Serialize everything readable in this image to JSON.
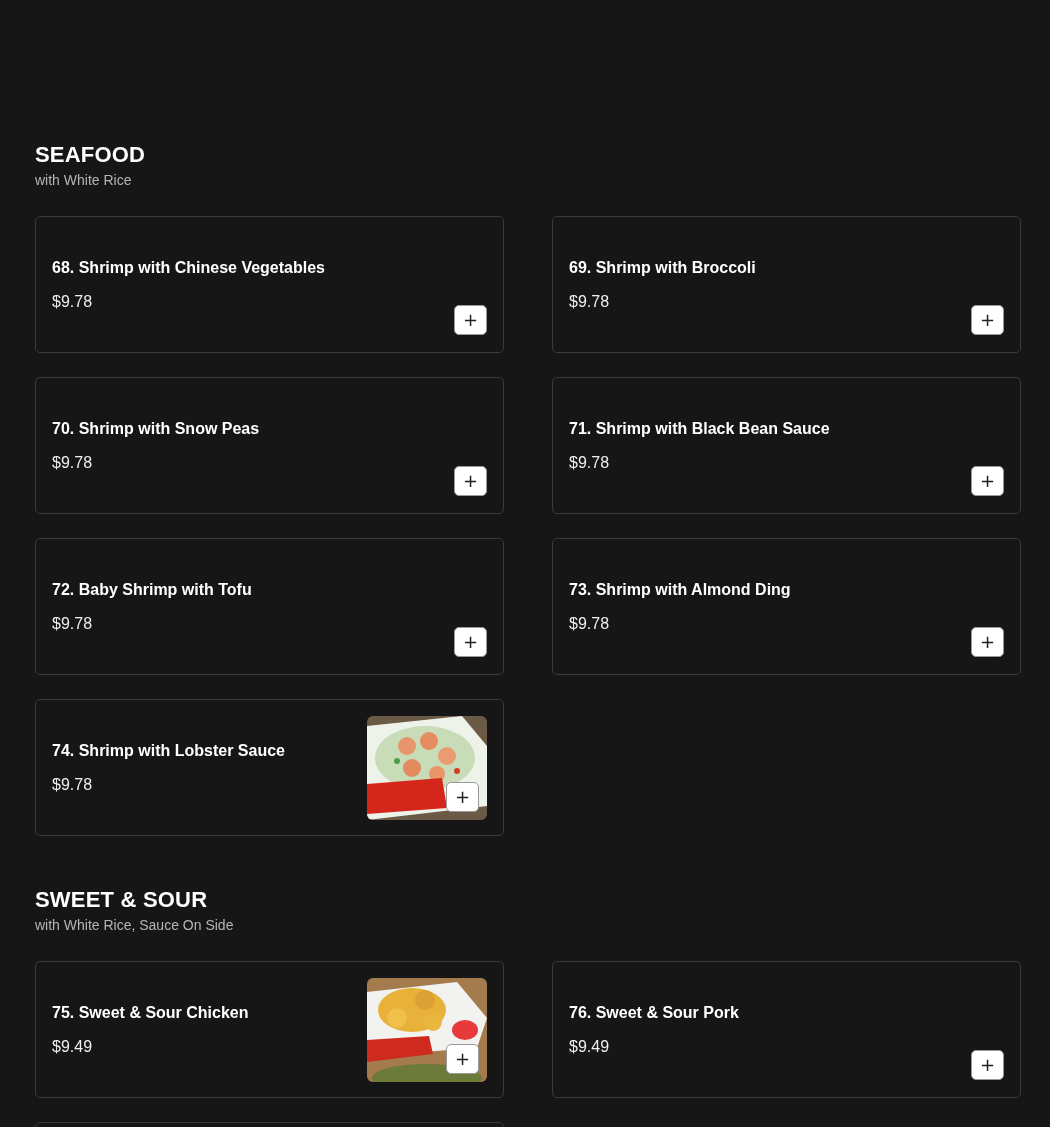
{
  "sections": [
    {
      "title": "SEAFOOD",
      "subtitle": "with White Rice",
      "items": [
        {
          "kind": "dish",
          "name": "68. Shrimp with Chinese Vegetables",
          "price": "$9.78",
          "add": "+"
        },
        {
          "kind": "dish",
          "name": "69. Shrimp with Broccoli",
          "price": "$9.78",
          "add": "+"
        },
        {
          "kind": "dish",
          "name": "70. Shrimp with Snow Peas",
          "price": "$9.78",
          "add": "+"
        },
        {
          "kind": "dish",
          "name": "71. Shrimp with Black Bean Sauce",
          "price": "$9.78",
          "add": "+"
        },
        {
          "kind": "dish",
          "name": "72. Baby Shrimp with Tofu",
          "price": "$9.78",
          "add": "+"
        },
        {
          "kind": "dish",
          "name": "73. Shrimp with Almond Ding",
          "price": "$9.78",
          "add": "+"
        },
        {
          "kind": "dish",
          "name": "74. Shrimp with Lobster Sauce",
          "price": "$9.78",
          "add": "+"
        }
      ]
    },
    {
      "title": "SWEET & SOUR",
      "subtitle": "with White Rice, Sauce On Side",
      "items": [
        {
          "kind": "dish",
          "name": "75. Sweet & Sour Chicken",
          "price": "$9.49",
          "add": "+"
        },
        {
          "kind": "dish",
          "name": "76. Sweet & Sour Pork",
          "price": "$9.49",
          "add": "+"
        },
        {
          "kind": "cut_off"
        }
      ]
    }
  ]
}
